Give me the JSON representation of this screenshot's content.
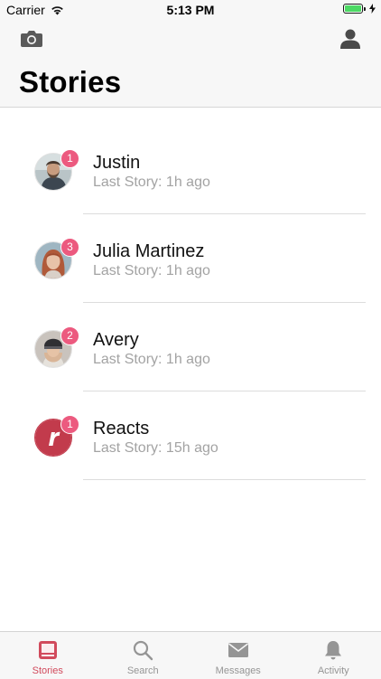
{
  "status_bar": {
    "carrier": "Carrier",
    "time": "5:13 PM",
    "battery_color": "#4cd964"
  },
  "header": {
    "title": "Stories",
    "left_icon": "camera-icon",
    "right_icon": "user-icon"
  },
  "stories": [
    {
      "name": "Justin",
      "subtitle": "Last Story: 1h ago",
      "badge": "1",
      "avatar": "photo-man-beard"
    },
    {
      "name": "Julia Martinez",
      "subtitle": "Last Story: 1h ago",
      "badge": "3",
      "avatar": "photo-woman-red-hair"
    },
    {
      "name": "Avery",
      "subtitle": "Last Story: 1h ago",
      "badge": "2",
      "avatar": "photo-woman-beanie"
    },
    {
      "name": "Reacts",
      "subtitle": "Last Story: 15h ago",
      "badge": "1",
      "avatar": "logo-r"
    }
  ],
  "tabs": [
    {
      "label": "Stories",
      "icon": "stories-icon",
      "active": true
    },
    {
      "label": "Search",
      "icon": "search-icon",
      "active": false
    },
    {
      "label": "Messages",
      "icon": "envelope-icon",
      "active": false
    },
    {
      "label": "Activity",
      "icon": "bell-icon",
      "active": false
    }
  ],
  "colors": {
    "accent": "#d14a5c",
    "badge": "#ec5a7f",
    "inactive": "#959595"
  }
}
